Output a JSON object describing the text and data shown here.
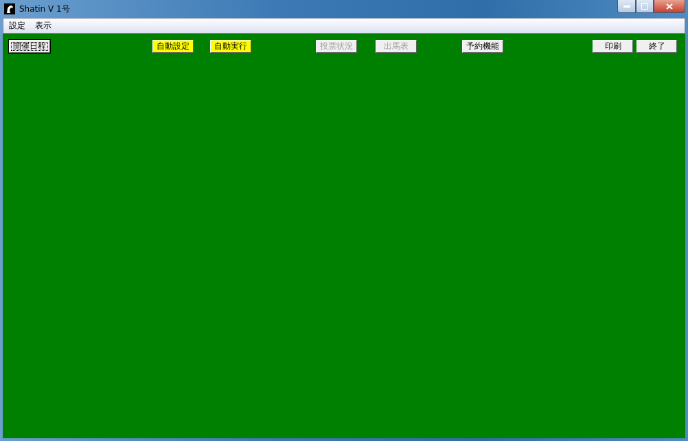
{
  "window": {
    "title": "Shatin V 1号"
  },
  "menu": [
    {
      "label": "設定"
    },
    {
      "label": "表示"
    }
  ],
  "buttons": [
    {
      "label": "開催日程",
      "disabled": false,
      "focused": true,
      "color": "#f0f0f0"
    },
    {
      "label": "自動設定",
      "disabled": false,
      "focused": false,
      "color": "#ffff00"
    },
    {
      "label": "自動実行",
      "disabled": false,
      "focused": false,
      "color": "#ffff00"
    },
    {
      "label": "投票状況",
      "disabled": true,
      "focused": false,
      "color": "#f0f0f0"
    },
    {
      "label": "出馬表",
      "disabled": true,
      "focused": false,
      "color": "#f0f0f0"
    },
    {
      "label": "予約機能",
      "disabled": false,
      "focused": false,
      "color": "#f0f0f0"
    },
    {
      "label": "印刷",
      "disabled": false,
      "focused": false,
      "color": "#f0f0f0"
    },
    {
      "label": "終了",
      "disabled": false,
      "focused": false,
      "color": "#f0f0f0"
    }
  ]
}
